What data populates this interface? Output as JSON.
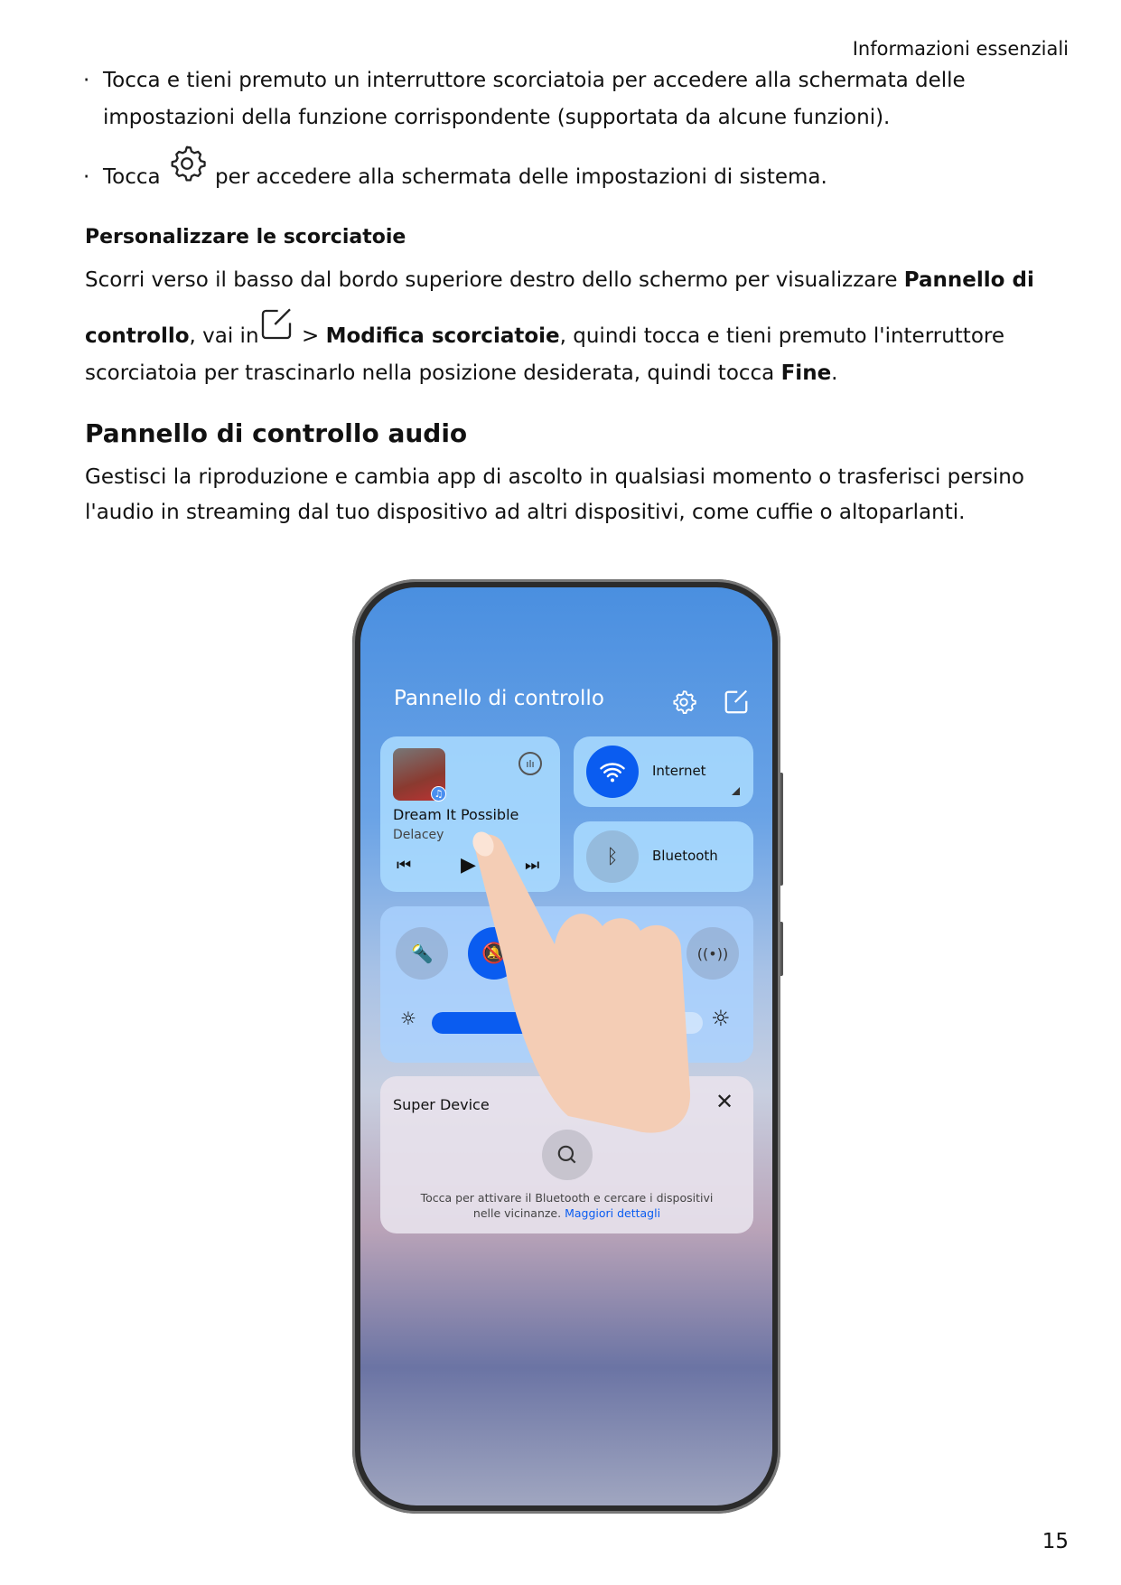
{
  "header": "Informazioni essenziali",
  "bullets": [
    {
      "line1": "Tocca e tieni premuto un interruttore scorciatoia per accedere alla schermata delle",
      "line2": "impostazioni della funzione corrispondente (supportata da alcune funzioni)."
    },
    {
      "pre": "Tocca",
      "post": "per accedere alla schermata delle impostazioni di sistema.",
      "icon": "gear-icon"
    }
  ],
  "section1": {
    "title": "Personalizzare le scorciatoie",
    "p1": "Scorri verso il basso dal bordo superiore destro dello schermo per visualizzare ",
    "p1b": "Pannello di",
    "p2b": "controllo",
    "p2": ", vai in",
    "p2c": " > ",
    "p2d": "Modifica scorciatoie",
    "p2e": ", quindi tocca e tieni premuto l'interruttore",
    "p3": "scorciatoia per trascinarlo nella posizione desiderata, quindi tocca ",
    "p3b": "Fine",
    "p3c": "."
  },
  "section2": {
    "title": "Pannello di controllo audio",
    "line1": "Gestisci la riproduzione e cambia app di ascolto in qualsiasi momento o trasferisci persino",
    "line2": "l'audio in streaming dal tuo dispositivo ad altri dispositivi, come cuffie o altoparlanti."
  },
  "phone": {
    "title": "Pannello di controllo",
    "media": {
      "song": "Dream It Possible",
      "artist": "Delacey"
    },
    "internet": "Internet",
    "bluetooth": "Bluetooth",
    "brightness_fraction": 0.45,
    "super_device": {
      "title": "Super Device",
      "desc1": "Tocca per attivare il Bluetooth e cercare i dispositivi",
      "desc2": "nelle vicinanze. ",
      "link": "Maggiori dettagli"
    },
    "colors": {
      "accent": "#0a5cf0"
    }
  },
  "page_number": "15"
}
